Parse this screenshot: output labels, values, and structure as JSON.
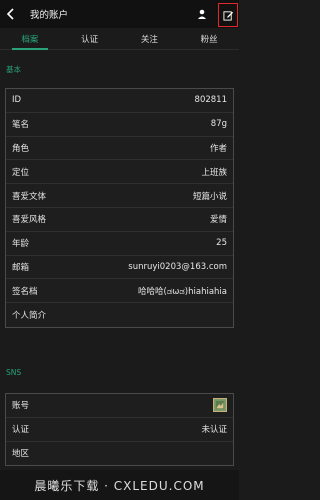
{
  "header": {
    "title": "我的账户"
  },
  "tabs": [
    {
      "label": "档案",
      "active": true
    },
    {
      "label": "认证",
      "active": false
    },
    {
      "label": "关注",
      "active": false
    },
    {
      "label": "粉丝",
      "active": false
    }
  ],
  "basic": {
    "section_label": "基本",
    "rows": [
      {
        "key": "ID",
        "value": "802811"
      },
      {
        "key": "笔名",
        "value": "87g"
      },
      {
        "key": "角色",
        "value": "作者"
      },
      {
        "key": "定位",
        "value": "上班族"
      },
      {
        "key": "喜爱文体",
        "value": "短篇小说"
      },
      {
        "key": "喜爱风格",
        "value": "爱情"
      },
      {
        "key": "年龄",
        "value": "25"
      },
      {
        "key": "邮箱",
        "value": "sunruyi0203@163.com"
      },
      {
        "key": "签名档",
        "value": "哈哈哈(ಡωಡ)hiahiahia"
      },
      {
        "key": "个人简介",
        "value": ""
      }
    ]
  },
  "sns": {
    "section_label": "SNS",
    "rows": [
      {
        "key": "账号",
        "value": ""
      },
      {
        "key": "认证",
        "value": "未认证"
      },
      {
        "key": "地区",
        "value": ""
      }
    ]
  },
  "watermark": {
    "text": "晨曦乐下载 · CXLEDU.COM"
  },
  "colors": {
    "accent": "#2aa37d",
    "highlight": "#e02a2a",
    "background": "#1b1b1b"
  },
  "icons": {
    "back": "back-arrow-icon",
    "person": "person-icon",
    "edit": "edit-icon",
    "avatar": "avatar-icon"
  }
}
